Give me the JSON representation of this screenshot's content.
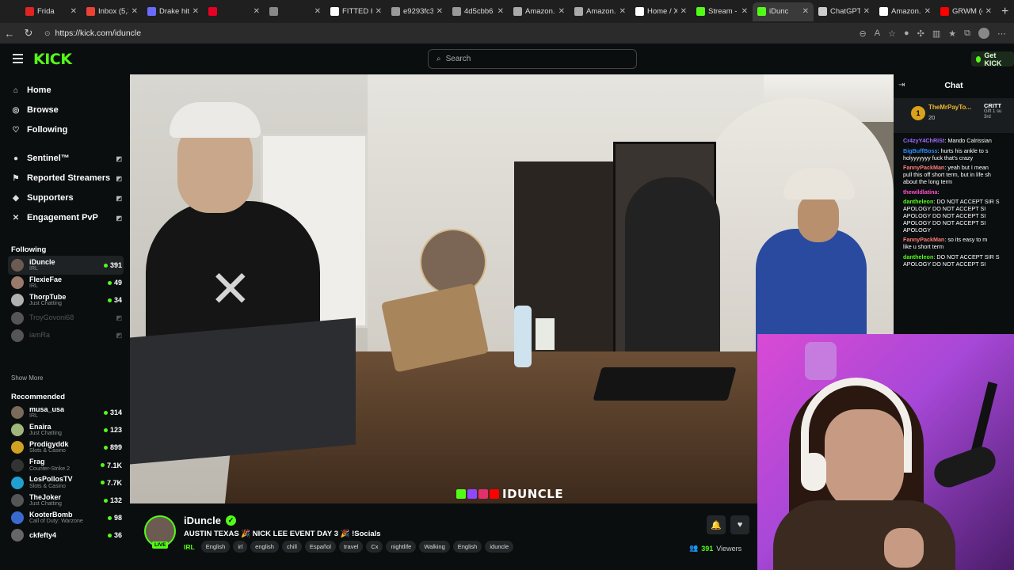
{
  "browser": {
    "tabs": [
      {
        "title": "Frida",
        "color": "#e02424"
      },
      {
        "title": "Inbox (5,3",
        "color": "#ea4335"
      },
      {
        "title": "Drake hit",
        "color": "#6b6bff"
      },
      {
        "title": "",
        "color": "#e60023"
      },
      {
        "title": "",
        "color": "#888888"
      },
      {
        "title": "FITTED H",
        "color": "#ffffff"
      },
      {
        "title": "e9293fc3",
        "color": "#999999"
      },
      {
        "title": "4d5cbb6",
        "color": "#999999"
      },
      {
        "title": "Amazon.c",
        "color": "#aaaaaa"
      },
      {
        "title": "Amazon.c",
        "color": "#aaaaaa"
      },
      {
        "title": "Home / X",
        "color": "#ffffff"
      },
      {
        "title": "Stream - ",
        "color": "#53fc18"
      },
      {
        "title": "iDunc",
        "color": "#53fc18"
      },
      {
        "title": "ChatGPT",
        "color": "#cccccc"
      },
      {
        "title": "Amazon.c",
        "color": "#ffffff"
      },
      {
        "title": "GRWM (o",
        "color": "#ff0000"
      }
    ],
    "url": "https://kick.com/idunclе"
  },
  "header": {
    "logo": "KICK",
    "search_placeholder": "Search",
    "get_kick": "Get KICK"
  },
  "sidebar": {
    "nav": [
      {
        "label": "Home",
        "icon": "home-icon"
      },
      {
        "label": "Browse",
        "icon": "compass-icon"
      },
      {
        "label": "Following",
        "icon": "heart-icon"
      }
    ],
    "extensions": [
      {
        "label": "Sentinel™"
      },
      {
        "label": "Reported Streamers"
      },
      {
        "label": "Supporters"
      },
      {
        "label": "Engagement PvP"
      }
    ],
    "following_heading": "Following",
    "following": [
      {
        "name": "iDuncle",
        "category": "IRL",
        "viewers": "391",
        "color": "#6b5b50",
        "live": true
      },
      {
        "name": "FlexieFae",
        "category": "IRL",
        "viewers": "49",
        "color": "#9a7a6a",
        "live": true
      },
      {
        "name": "ThorpTube",
        "category": "Just Chatting",
        "viewers": "34",
        "color": "#b0b0b0",
        "live": true
      },
      {
        "name": "TroyGovoni68",
        "category": "",
        "viewers": "",
        "color": "#555555",
        "live": false
      },
      {
        "name": "iamRa",
        "category": "",
        "viewers": "",
        "color": "#555555",
        "live": false
      }
    ],
    "show_more": "Show More",
    "recommended_heading": "Recommended",
    "recommended": [
      {
        "name": "musa_usa",
        "category": "IRL",
        "viewers": "314",
        "color": "#7a6a5a"
      },
      {
        "name": "Enaira",
        "category": "Just Chatting",
        "viewers": "123",
        "color": "#9fb87a"
      },
      {
        "name": "Prodigyddk",
        "category": "Slots & Casino",
        "viewers": "899",
        "color": "#d0a020"
      },
      {
        "name": "Frag",
        "category": "Counter-Strike 2",
        "viewers": "7.1K",
        "color": "#333333"
      },
      {
        "name": "LosPollosTV",
        "category": "Slots & Casino",
        "viewers": "7.7K",
        "color": "#20a0d0"
      },
      {
        "name": "TheJoker",
        "category": "Just Chatting",
        "viewers": "132",
        "color": "#555555"
      },
      {
        "name": "KooterBomb",
        "category": "Call of Duty: Warzone",
        "viewers": "98",
        "color": "#3a6ad0"
      },
      {
        "name": "ckfefty4",
        "category": "",
        "viewers": "36",
        "color": "#666666"
      }
    ]
  },
  "video": {
    "watermark": "IDUNCLE"
  },
  "channel": {
    "name": "iDuncle",
    "live_badge": "LIVE",
    "verified": "✓",
    "title": "AUSTIN TEXAS 🎉 NICK LEE EVENT DAY 3 🎉 !Socials",
    "category": "IRL",
    "tags": [
      "English",
      "irl",
      "english",
      "chill",
      "Español",
      "travel",
      "Cx",
      "nightlife",
      "Walking",
      "English",
      "iduncle"
    ],
    "viewers": "391",
    "viewers_label": "Viewers"
  },
  "chat": {
    "title": "Chat",
    "pinned": {
      "name": "TheMrPayTo...",
      "sub": "20",
      "right": "CRITT",
      "right_sub": "Gift 1 su",
      "right_sub2": "3rd"
    },
    "messages": [
      {
        "user": "Cr4zyY4ChRiSt",
        "color": "#a06bff",
        "text": "Mando Calrissian"
      },
      {
        "user": "BigBuffBoss",
        "color": "#2e8bff",
        "text": "hurts his ankle to s\nholyyyyyyy fuck that's crazy"
      },
      {
        "user": "FannyPackMan",
        "color": "#ff7a7a",
        "text": "yeah but I mean\npull this off short term, but in life sh\nabout the long term"
      },
      {
        "user": "thewildlatina",
        "color": "#ff4fc8",
        "text": ""
      },
      {
        "user": "dantheleon",
        "color": "#53fc18",
        "text": "DO NOT ACCEPT SIR S\nAPOLOGY DO NOT ACCEPT SI\nAPOLOGY DO NOT ACCEPT SI\nAPOLOGY DO NOT ACCEPT SI\nAPOLOGY"
      },
      {
        "user": "FannyPackMan",
        "color": "#ff7a7a",
        "text": "so its easy to m\nlike u short term"
      },
      {
        "user": "dantheleon",
        "color": "#53fc18",
        "text": "DO NOT ACCEPT SIR S\nAPOLOGY DO NOT ACCEPT SI"
      }
    ]
  }
}
